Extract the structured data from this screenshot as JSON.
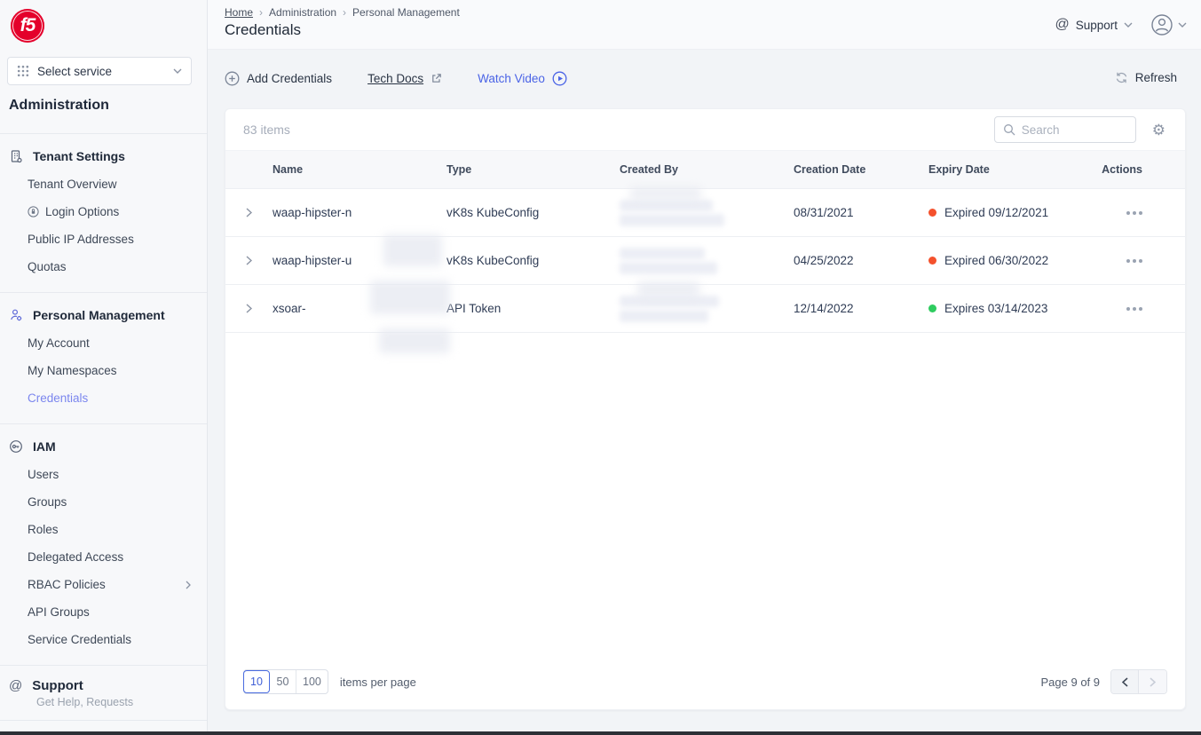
{
  "brand": {
    "logo_text": "f5"
  },
  "sidebar": {
    "service_selector": {
      "label": "Select service"
    },
    "title": "Administration",
    "sections": [
      {
        "label": "Tenant Settings",
        "items": [
          {
            "label": "Tenant Overview"
          },
          {
            "label": "Login Options",
            "icon": "sso-lock-icon"
          },
          {
            "label": "Public IP Addresses"
          },
          {
            "label": "Quotas"
          }
        ]
      },
      {
        "label": "Personal Management",
        "items": [
          {
            "label": "My Account"
          },
          {
            "label": "My Namespaces"
          },
          {
            "label": "Credentials",
            "active": true
          }
        ]
      },
      {
        "label": "IAM",
        "items": [
          {
            "label": "Users"
          },
          {
            "label": "Groups"
          },
          {
            "label": "Roles"
          },
          {
            "label": "Delegated Access"
          },
          {
            "label": "RBAC Policies",
            "expandable": true
          },
          {
            "label": "API Groups"
          },
          {
            "label": "Service Credentials"
          }
        ]
      }
    ],
    "support": {
      "label": "Support",
      "sublabel": "Get Help, Requests"
    }
  },
  "header": {
    "breadcrumb": {
      "home": "Home",
      "level1": "Administration",
      "level2": "Personal Management",
      "separator": "›"
    },
    "title": "Credentials",
    "support_label": "Support"
  },
  "toolbar": {
    "add_credentials": "Add Credentials",
    "tech_docs": "Tech Docs",
    "watch_video": "Watch Video",
    "refresh": "Refresh"
  },
  "panel": {
    "items_count": "83 items",
    "search_placeholder": "Search",
    "columns": {
      "name": "Name",
      "type": "Type",
      "created_by": "Created By",
      "creation_date": "Creation Date",
      "expiry_date": "Expiry Date",
      "actions": "Actions"
    },
    "rows": [
      {
        "name": "waap-hipster-n",
        "name_redacted": true,
        "type": "vK8s KubeConfig",
        "created_by_redacted": true,
        "creation_date": "08/31/2021",
        "expiry": "Expired 09/12/2021",
        "status": "expired"
      },
      {
        "name": "waap-hipster-u",
        "name_redacted": true,
        "type": "vK8s KubeConfig",
        "created_by_redacted": true,
        "creation_date": "04/25/2022",
        "expiry": "Expired 06/30/2022",
        "status": "expired"
      },
      {
        "name": "xsoar-",
        "name_redacted": true,
        "type": "API Token",
        "created_by_redacted": true,
        "creation_date": "12/14/2022",
        "expiry": "Expires 03/14/2023",
        "status": "active"
      }
    ]
  },
  "pagination": {
    "sizes": [
      "10",
      "50",
      "100"
    ],
    "active_size": "10",
    "items_per_page_label": "items per page",
    "page_status": "Page 9 of 9"
  },
  "icons": {
    "service_grid": "3x3-dot-grid",
    "tenant_settings": "building",
    "personal_management": "person-with-gear",
    "iam": "circled-key",
    "support": "at-sign",
    "add": "circled-plus",
    "tech_docs": "external-link",
    "watch_video": "circled-play",
    "refresh": "circular-arrows",
    "search": "magnifier",
    "settings": "gear",
    "actions": "ellipsis"
  },
  "colors": {
    "brand_red": "#e4002b",
    "accent_blue": "#4a63e6",
    "active_sidebar_link": "#7b86ee",
    "status_expired": "#f4512c",
    "status_active": "#2ecc5f"
  }
}
